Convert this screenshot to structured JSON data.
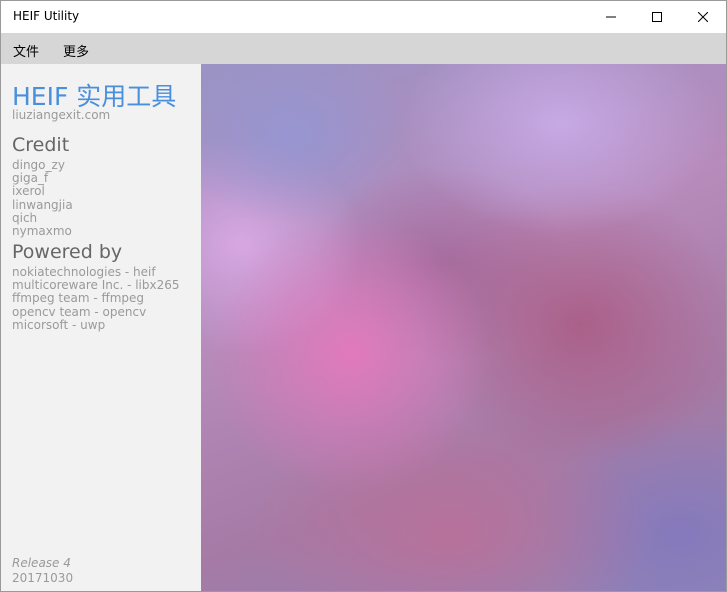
{
  "window": {
    "title": "HEIF Utility",
    "controls": {
      "minimize_icon": "minimize-icon",
      "maximize_icon": "maximize-icon",
      "close_icon": "close-icon"
    }
  },
  "menu": {
    "items": [
      {
        "label": "文件"
      },
      {
        "label": "更多"
      }
    ]
  },
  "sidebar": {
    "app_title": "HEIF 实用工具",
    "website": "liuziangexit.com",
    "credit": {
      "heading": "Credit",
      "names": [
        "dingo_zy",
        "giga_f",
        "ixerol",
        "linwangjia",
        "qich",
        "nymaxmo"
      ]
    },
    "powered_by": {
      "heading": "Powered by",
      "entries": [
        "nokiatechnologies - heif",
        "multicoreware Inc. - libx265",
        "ffmpeg team - ffmpeg",
        "opencv team - opencv",
        "micorsoft - uwp"
      ]
    },
    "release": "Release 4",
    "build_date": "20171030"
  },
  "colors": {
    "accent": "#4a8fdc",
    "menubar": "#d6d6d6",
    "sidebar": "#f2f2f2",
    "muted_text": "#9a9a9a"
  }
}
